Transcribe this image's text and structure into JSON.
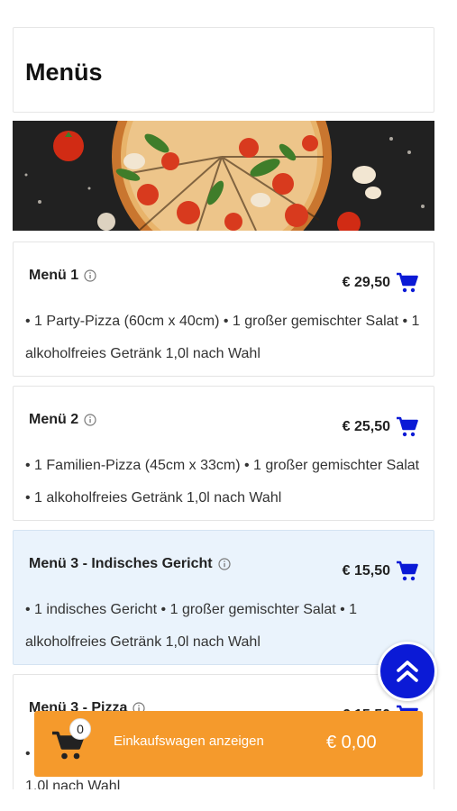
{
  "page": {
    "title": "Menüs"
  },
  "banner": {
    "alt": "Pizza"
  },
  "menus": [
    {
      "title": "Menü 1",
      "price": "€ 29,50",
      "description": "• 1 Party-Pizza (60cm x 40cm) • 1 großer gemischter Salat • 1 alkoholfreies Getränk 1,0l nach Wahl",
      "highlighted": false
    },
    {
      "title": "Menü 2",
      "price": "€ 25,50",
      "description": "• 1 Familien-Pizza (45cm x 33cm) • 1 großer gemischter Salat • 1 alkoholfreies Getränk 1,0l nach Wahl",
      "highlighted": false
    },
    {
      "title": "Menü 3 - Indisches Gericht",
      "price": "€ 15,50",
      "description": "• 1 indisches Gericht • 1 großer gemischter Salat • 1 alkoholfreies Getränk 1,0l nach Wahl",
      "highlighted": true
    },
    {
      "title": "Menü 3 - Pizza",
      "price": "€ 15,50",
      "description": "• 1 Pizza • 1 großer gemischter Salat • 1 alkoholfreies Getränk 1,0l nach Wahl",
      "highlighted": false
    }
  ],
  "cart": {
    "count": "0",
    "label": "Einkaufswagen anzeigen",
    "total": "€ 0,00"
  },
  "icons": {
    "info": "info-icon",
    "add_to_cart": "cart-icon",
    "scroll_top": "double-chevron-up-icon"
  },
  "colors": {
    "accent_blue": "#0b1ad6",
    "cart_bar": "#f59a2c",
    "highlight_bg": "#eaf3fc"
  }
}
